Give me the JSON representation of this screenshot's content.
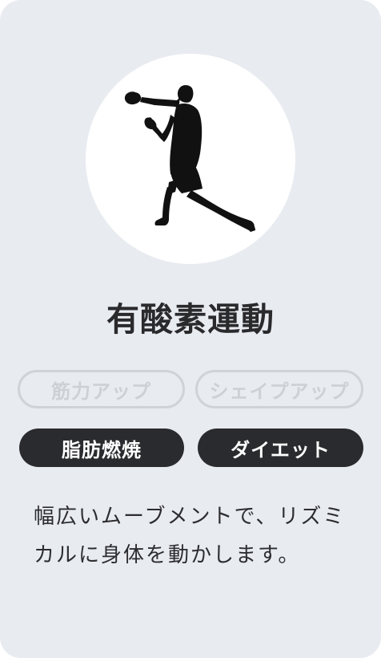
{
  "card": {
    "title": "有酸素運動",
    "description": "幅広いムーブメントで、リズミカルに身体を動かします。",
    "image_icon": "boxer-silhouette-icon",
    "tags": [
      {
        "label": "筋力アップ",
        "active": false
      },
      {
        "label": "シェイプアップ",
        "active": false
      },
      {
        "label": "脂肪燃焼",
        "active": true
      },
      {
        "label": "ダイエット",
        "active": true
      }
    ]
  },
  "colors": {
    "card_background": "#e8ebf0",
    "active_tag": "#2a2b2e",
    "inactive_tag_border": "#cfd2d6",
    "text": "#2a2a2d"
  }
}
